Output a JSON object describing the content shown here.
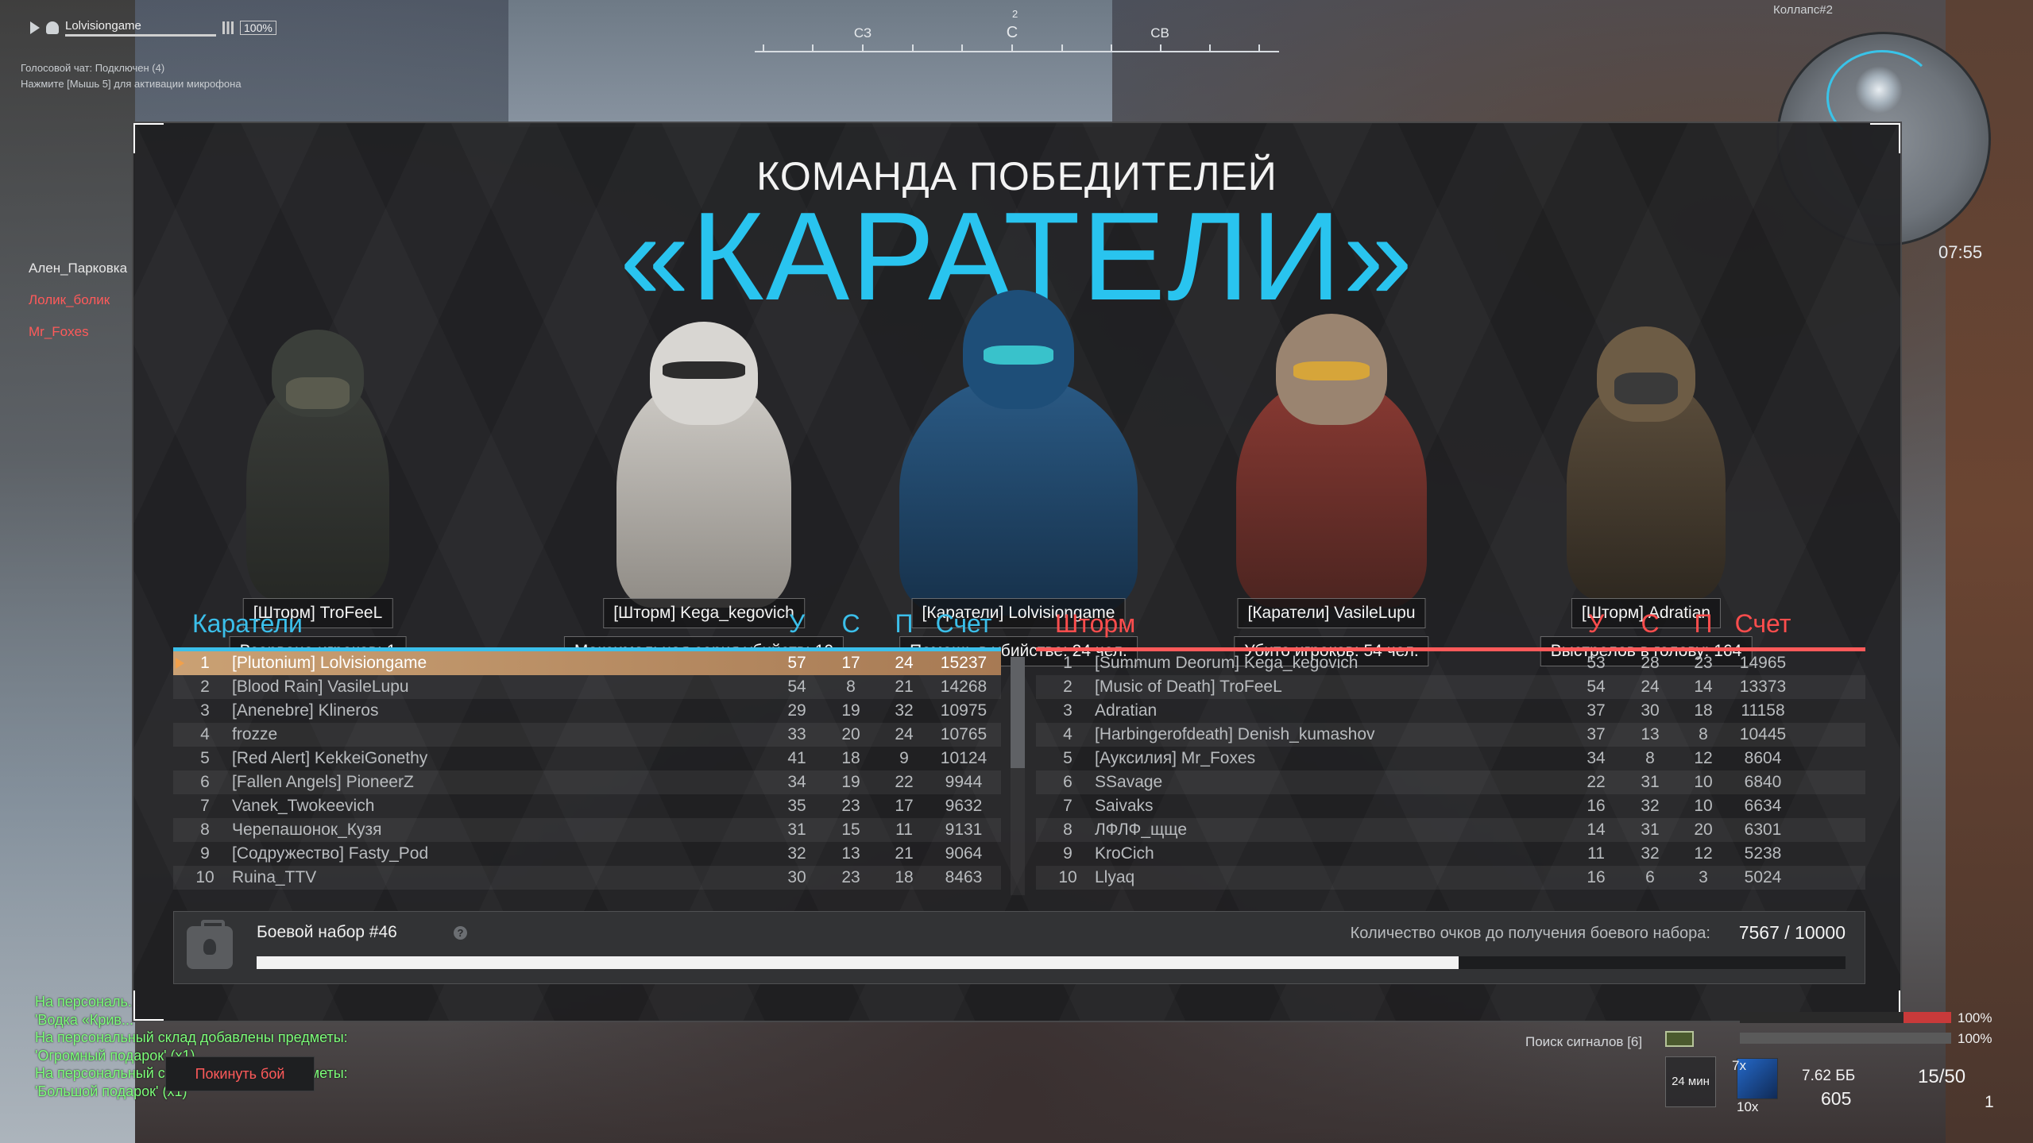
{
  "hud": {
    "player_name": "Lolvisiongame",
    "volume": "100%",
    "voice_line1": "Голосовой чат: Подключен (4)",
    "voice_line2": "Нажмите [Мышь 5] для активации микрофона",
    "compass": {
      "degree": "2",
      "labels": [
        "СЗ",
        "С",
        "СВ"
      ]
    },
    "map_name": "Коллапс#2",
    "timer": "07:55",
    "kill_feed": [
      "Ален_Парковка",
      "Лолик_болик",
      "Mr_Foxes"
    ],
    "chat": [
      "На персональ...",
      "'Водка «Крив...",
      "На персональный склад добавлены предметы:",
      "'Огромный подарок' (x1)",
      "На персональный склад добавлены предметы:",
      "'Большой подарок' (x1)"
    ],
    "leave_button": "Покинуть бой",
    "signal_label": "Поиск сигналов [6]",
    "hp": "100%",
    "armor": "100%",
    "time_left": "24 мин",
    "item_count": "7x",
    "medkits": "10x",
    "caliber": "7.62 ББ",
    "ammo_reserve": "605",
    "mag": "15/50",
    "grenades": "1"
  },
  "panel": {
    "subtitle": "КОМАНДА ПОБЕДИТЕЛЕЙ",
    "title": "«КАРАТЕЛИ»",
    "highlights": [
      {
        "name": "[Шторм] TroFeeL",
        "stat": "Взорвано игроков: 1",
        "helmet": "#3b3f3a",
        "visor": "#8b1a1a"
      },
      {
        "name": "[Шторм] Kega_kegovich",
        "stat": "Максимальная серия убийств: 10",
        "helmet": "#d8d6d2",
        "visor": "#2c2c2c"
      },
      {
        "name": "[Каратели] Lolvisiongame",
        "stat": "Помощь в убийстве: 24 чел.",
        "helmet": "#1e4e78",
        "visor": "#40e0e0"
      },
      {
        "name": "[Каратели] VasileLupu",
        "stat": "Убито игроков: 54 чел.",
        "helmet": "#8a3a33",
        "visor": "#d6a53a"
      },
      {
        "name": "[Шторм] Adratian",
        "stat": "Выстрелов в голову: 164",
        "helmet": "#5c4e3c",
        "visor": "#3a3a3a"
      }
    ],
    "columns": {
      "kills": "У",
      "deaths": "С",
      "assists": "П",
      "score": "Счет"
    },
    "team_left": {
      "name": "Каратели",
      "color": "#3bbfea",
      "rows": [
        {
          "rank": "1",
          "name": "[Plutonium] Lolvisiongame",
          "k": "57",
          "d": "17",
          "a": "24",
          "s": "15237"
        },
        {
          "rank": "2",
          "name": "[Blood Rain] VasileLupu",
          "k": "54",
          "d": "8",
          "a": "21",
          "s": "14268"
        },
        {
          "rank": "3",
          "name": "[Anenebre] Klineros",
          "k": "29",
          "d": "19",
          "a": "32",
          "s": "10975"
        },
        {
          "rank": "4",
          "name": "frozze",
          "k": "33",
          "d": "20",
          "a": "24",
          "s": "10765"
        },
        {
          "rank": "5",
          "name": "[Red Alert] KekkeiGonethy",
          "k": "41",
          "d": "18",
          "a": "9",
          "s": "10124"
        },
        {
          "rank": "6",
          "name": "[Fallen Angels] PioneerZ",
          "k": "34",
          "d": "19",
          "a": "22",
          "s": "9944"
        },
        {
          "rank": "7",
          "name": "Vanek_Twokeevich",
          "k": "35",
          "d": "23",
          "a": "17",
          "s": "9632"
        },
        {
          "rank": "8",
          "name": "Черепашонок_Кузя",
          "k": "31",
          "d": "15",
          "a": "11",
          "s": "9131"
        },
        {
          "rank": "9",
          "name": "[Содружество] Fasty_Pod",
          "k": "32",
          "d": "13",
          "a": "21",
          "s": "9064"
        },
        {
          "rank": "10",
          "name": "Ruina_TTV",
          "k": "30",
          "d": "23",
          "a": "18",
          "s": "8463"
        }
      ]
    },
    "team_right": {
      "name": "Шторм",
      "color": "#ff4d4d",
      "rows": [
        {
          "rank": "1",
          "name": "[Summum Deorum] Kega_kegovich",
          "k": "53",
          "d": "28",
          "a": "23",
          "s": "14965"
        },
        {
          "rank": "2",
          "name": "[Music of Death] TroFeeL",
          "k": "54",
          "d": "24",
          "a": "14",
          "s": "13373"
        },
        {
          "rank": "3",
          "name": "Adratian",
          "k": "37",
          "d": "30",
          "a": "18",
          "s": "11158"
        },
        {
          "rank": "4",
          "name": "[Harbingerofdeath] Denish_kumashov",
          "k": "37",
          "d": "13",
          "a": "8",
          "s": "10445"
        },
        {
          "rank": "5",
          "name": "[Ауксилия] Mr_Foxes",
          "k": "34",
          "d": "8",
          "a": "12",
          "s": "8604"
        },
        {
          "rank": "6",
          "name": "SSavage",
          "k": "22",
          "d": "31",
          "a": "10",
          "s": "6840"
        },
        {
          "rank": "7",
          "name": "Saivaks",
          "k": "16",
          "d": "32",
          "a": "10",
          "s": "6634"
        },
        {
          "rank": "8",
          "name": "ЛФЛФ_щще",
          "k": "14",
          "d": "31",
          "a": "20",
          "s": "6301"
        },
        {
          "rank": "9",
          "name": "KroCich",
          "k": "11",
          "d": "32",
          "a": "12",
          "s": "5238"
        },
        {
          "rank": "10",
          "name": "Llyaq",
          "k": "16",
          "d": "6",
          "a": "3",
          "s": "5024"
        }
      ]
    },
    "battle_kit": {
      "title": "Боевой набор #46",
      "label": "Количество очков до получения боевого набора:",
      "value": "7567 / 10000",
      "progress": 0.7567
    }
  }
}
